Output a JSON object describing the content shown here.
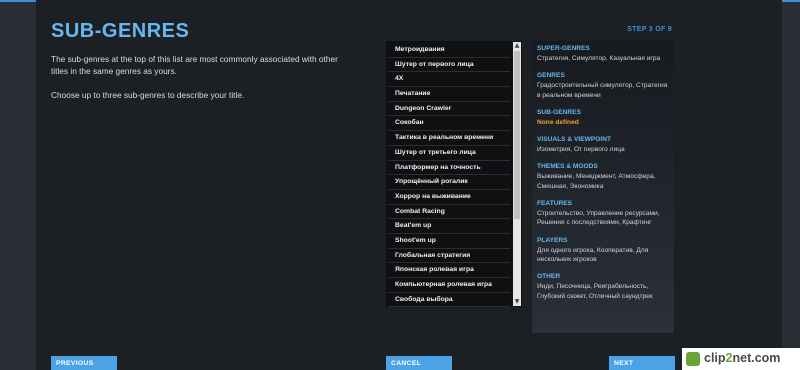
{
  "header": {
    "title": "SUB-GENRES",
    "step": "STEP 3 OF 9"
  },
  "description": {
    "p1": "The sub-genres at the top of this list are most commonly associated with other titles in the same genres as yours.",
    "p2": "Choose up to three sub-genres to describe your title."
  },
  "list": {
    "items": [
      "Метроидвания",
      "Шутер от первого лица",
      "4X",
      "Печатание",
      "Dungeon Crawler",
      "Сокобан",
      "Тактика в реальном времени",
      "Шутер от третьего лица",
      "Платформер на точность",
      "Упрощённый рогалик",
      "Хоррор на выживание",
      "Combat Racing",
      "Beat'em up",
      "Shoot'em up",
      "Глобальная стратегия",
      "Японская ролевая игра",
      "Компьютерная ролевая игра",
      "Свобода выбора"
    ]
  },
  "summary": [
    {
      "heading": "SUPER-GENRES",
      "value": "Стратегия, Симулятор, Казуальная игра",
      "highlight": false
    },
    {
      "heading": "GENRES",
      "value": "Градостроительный симулятор, Стратегия в реальном времени",
      "highlight": false
    },
    {
      "heading": "SUB-GENRES",
      "value": "None defined",
      "highlight": true
    },
    {
      "heading": "VISUALS & VIEWPOINT",
      "value": "Изометрия, От первого лица",
      "highlight": false
    },
    {
      "heading": "THEMES & MOODS",
      "value": "Выживание, Менеджмент, Атмосфера, Смешная, Экономика",
      "highlight": false
    },
    {
      "heading": "FEATURES",
      "value": "Строительство, Управление ресурсами, Решения с последствиями, Крафтинг",
      "highlight": false
    },
    {
      "heading": "PLAYERS",
      "value": "Для одного игрока, Кооператив, Для нескольких игроков",
      "highlight": false
    },
    {
      "heading": "OTHER",
      "value": "Инди, Песочница, Реиграбельность, Глубокий сюжет, Отличный саундтрек",
      "highlight": false
    }
  ],
  "buttons": {
    "previous": "PREVIOUS",
    "cancel": "CANCEL",
    "next": "NEXT"
  },
  "scrollbar": {
    "up_icon": "▲",
    "down_icon": "▼"
  },
  "watermark": {
    "prefix": "clip",
    "accent": "2",
    "suffix": "net.com"
  },
  "colors": {
    "accent": "#66b8f0",
    "button": "#4ba3e6",
    "highlight": "#f0a030",
    "background": "#1c1f24"
  }
}
